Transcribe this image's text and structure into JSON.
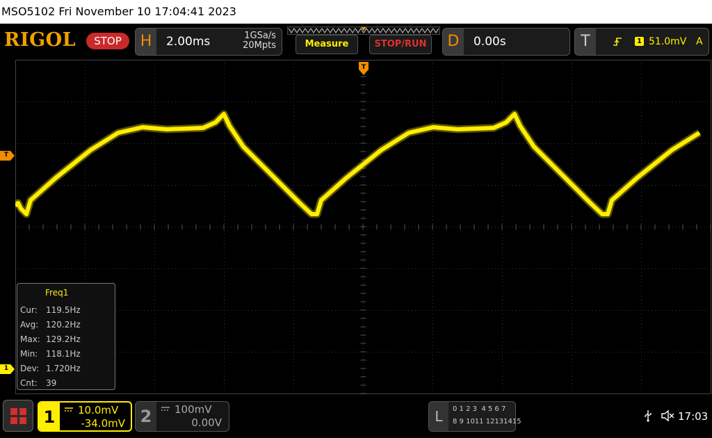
{
  "title_bar": {
    "text": "MSO5102  Fri November 10 17:04:41 2023"
  },
  "toolbar": {
    "brand": "RIGOL",
    "run_state": "STOP",
    "horizontal": {
      "letter": "H",
      "timebase": "2.00ms",
      "sample_rate": "1GSa/s",
      "memory_depth": "20Mpts"
    },
    "measure_label": "Measure",
    "stoprun_label": "STOP/RUN",
    "delay": {
      "letter": "D",
      "value": "0.00s"
    },
    "trigger": {
      "letter": "T",
      "channel": "1",
      "level": "51.0mV",
      "mode": "A"
    }
  },
  "markers": {
    "trigger_position": "T",
    "trigger_level": "T",
    "channel1": "1"
  },
  "measurement": {
    "title": "Freq1",
    "rows": [
      {
        "label": "Cur:",
        "value": "119.5Hz"
      },
      {
        "label": "Avg:",
        "value": "120.2Hz"
      },
      {
        "label": "Max:",
        "value": "129.2Hz"
      },
      {
        "label": "Min:",
        "value": "118.1Hz"
      },
      {
        "label": "Dev:",
        "value": "1.720Hz"
      },
      {
        "label": "Cnt:",
        "value": "39"
      }
    ]
  },
  "channels": [
    {
      "num": "1",
      "scale": "10.0mV",
      "offset": "-34.0mV",
      "color": "#ffee00"
    },
    {
      "num": "2",
      "scale": "100mV",
      "offset": "0.00V",
      "color": "#888888"
    }
  ],
  "logic": {
    "letter": "L",
    "row1": "0 1 2 3  4 5 6 7",
    "row2": "8 9 1011 12131415"
  },
  "status": {
    "time": "17:03"
  },
  "icons": [
    "menu-icon",
    "usb-icon",
    "speaker-muted-icon"
  ],
  "colors": {
    "ch1": "#ffee00",
    "accent": "#f08c00",
    "stop": "#c92a2a"
  }
}
